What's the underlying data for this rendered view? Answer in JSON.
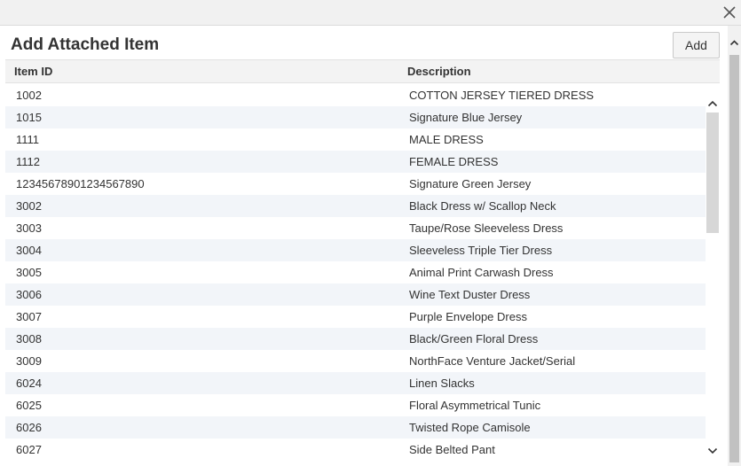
{
  "dialog": {
    "title": "Add Attached Item",
    "add_label": "Add"
  },
  "grid": {
    "columns": [
      "Item ID",
      "Description"
    ],
    "rows": [
      {
        "id": "1002",
        "description": "COTTON JERSEY TIERED DRESS"
      },
      {
        "id": "1015",
        "description": "Signature Blue Jersey"
      },
      {
        "id": "1111",
        "description": "MALE DRESS"
      },
      {
        "id": "1112",
        "description": "FEMALE DRESS"
      },
      {
        "id": "12345678901234567890",
        "description": "Signature Green Jersey"
      },
      {
        "id": "3002",
        "description": "Black Dress w/ Scallop Neck"
      },
      {
        "id": "3003",
        "description": "Taupe/Rose Sleeveless Dress"
      },
      {
        "id": "3004",
        "description": "Sleeveless Triple Tier Dress"
      },
      {
        "id": "3005",
        "description": "Animal Print Carwash Dress"
      },
      {
        "id": "3006",
        "description": "Wine Text Duster Dress"
      },
      {
        "id": "3007",
        "description": "Purple Envelope Dress"
      },
      {
        "id": "3008",
        "description": "Black/Green Floral Dress"
      },
      {
        "id": "3009",
        "description": "NorthFace Venture Jacket/Serial"
      },
      {
        "id": "6024",
        "description": "Linen Slacks"
      },
      {
        "id": "6025",
        "description": "Floral Asymmetrical Tunic"
      },
      {
        "id": "6026",
        "description": "Twisted Rope Camisole"
      },
      {
        "id": "6027",
        "description": "Side Belted Pant"
      }
    ]
  },
  "icons": {
    "close": "close-icon",
    "scroll_up": "chevron-up-icon",
    "scroll_down": "chevron-down-icon"
  }
}
